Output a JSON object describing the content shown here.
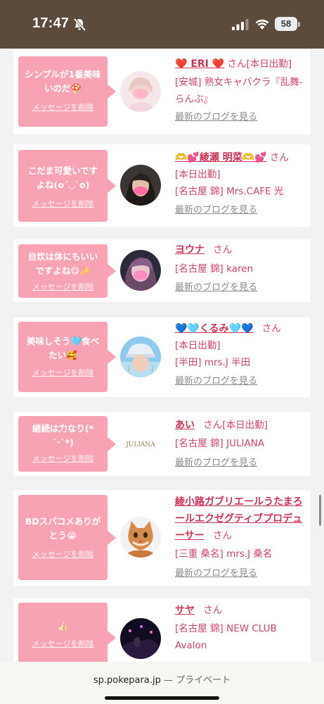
{
  "status_bar": {
    "time": "17:47",
    "battery": "58"
  },
  "messages": [
    {
      "message": "シンプルが1番美味いのだ🍄",
      "delete_label": "メッセージを削除",
      "name_prefix": "❤️",
      "name": "ERI",
      "name_suffix": "❤️",
      "san": "さん",
      "status": "[本日出勤]",
      "shop": "[安城] 熟女キャバクラ『乱舞-らんぶ』",
      "blog_label": "最新のブログを見る"
    },
    {
      "message": "こだま可愛いですよね(o´◡`o)",
      "delete_label": "メッセージを削除",
      "name": "🫶💕綾瀬 明菜🫶💕",
      "san": "さん",
      "status": "[本日出勤]",
      "shop": "[名古屋 錦] Mrs.CAFE 光",
      "blog_label": "最新のブログを見る"
    },
    {
      "message": "自炊は体にもいいですよね😋✨",
      "delete_label": "メッセージを削除",
      "name": "ヨウナ",
      "san": "さん",
      "shop": "[名古屋 錦] karen",
      "blog_label": "最新のブログを見る"
    },
    {
      "message": "美味しそう🩵食べたい🥰",
      "delete_label": "メッセージを削除",
      "name": "💙🩵くるみ🩵💙",
      "san": "さん",
      "status": "[本日出勤]",
      "shop": "[半田] mrs.J 半田",
      "blog_label": "最新のブログを見る"
    },
    {
      "message": "継続は力なり(*´ᵕ`*)",
      "delete_label": "メッセージを削除",
      "avatar_text": "JULIANA",
      "name": "あい",
      "san": "さん",
      "status": "[本日出勤]",
      "shop": "[名古屋 錦] JULIANA",
      "blog_label": "最新のブログを見る"
    },
    {
      "message": "BDスパコメありがとう😭",
      "delete_label": "メッセージを削除",
      "name": "綾小路ガブリエールうたまろールエクゼグティブプロデューサー",
      "san": "さん",
      "shop": "[三重 桑名] mrs.J 桑名",
      "blog_label": "最新のブログを見る"
    },
    {
      "message": "👍🏻",
      "delete_label": "メッセージを削除",
      "name": "サヤ",
      "san": "さん",
      "shop": "[名古屋 錦] NEW CLUB Avalon"
    }
  ],
  "browser": {
    "domain": "sp.pokepara.jp",
    "mode": "— プライベート"
  },
  "colors": {
    "status_bar_bg": "#5c4a3b",
    "bubble_bg": "#f8a3b3",
    "name_color": "#cc3355",
    "text_color": "#cc4466",
    "link_gray": "#8a8a8a"
  },
  "icons": [
    "bell-slash-icon",
    "signal-icon",
    "wifi-icon",
    "battery-icon"
  ]
}
